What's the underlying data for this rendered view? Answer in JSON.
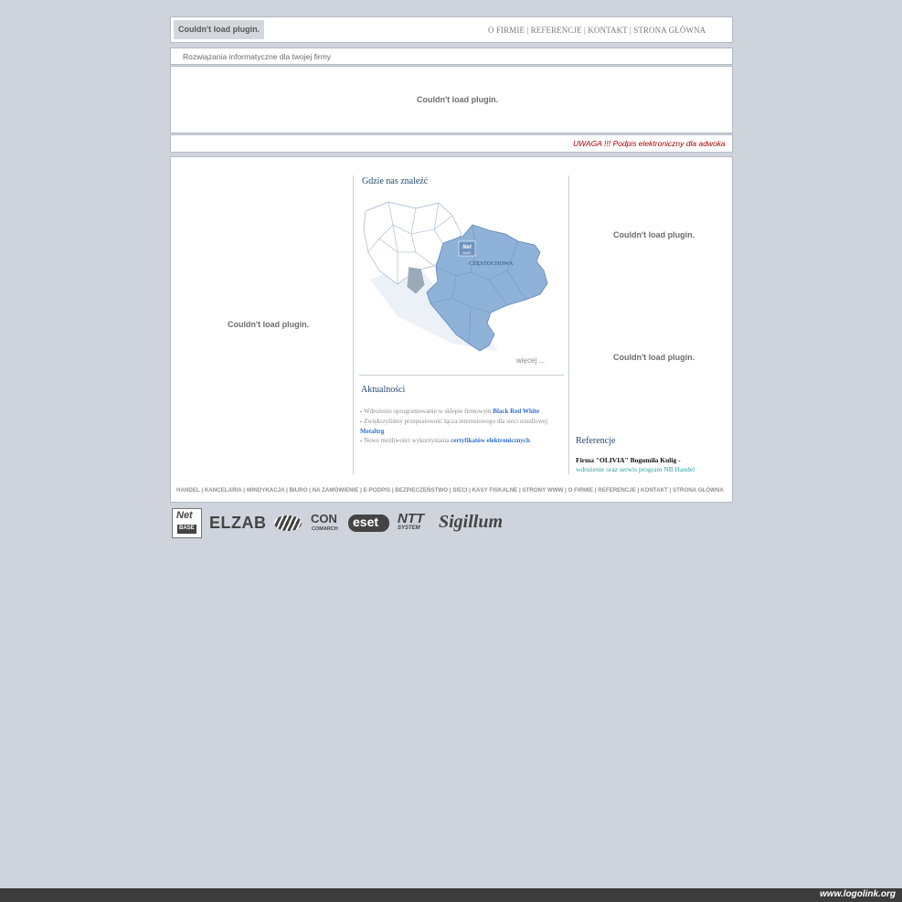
{
  "header": {
    "plugin_text": "Couldn't load plugin.",
    "nav": [
      "O FIRMIE",
      "REFERENCJE",
      "KONTAKT",
      "STRONA GŁÓWNA"
    ]
  },
  "tagline": "Rozwiązania informatyczne dla twojej firmy",
  "banner": {
    "plugin_text": "Couldn't load plugin."
  },
  "ticker": {
    "text": "UWAGA !!! Podpis elektroniczny dla adwokatów"
  },
  "left_column": {
    "plugin_text": "Couldn't load plugin."
  },
  "center_column": {
    "find_us_title": "Gdzie nas znaleźć",
    "map": {
      "city_label": "CZĘSTOCHOWA",
      "pin_logo_top": "Net",
      "pin_logo_bottom": "BASE"
    },
    "more_link": "więcej ...",
    "news_title": "Aktualności",
    "news": [
      {
        "dash": "-",
        "text": "Wdrożenie oprogramowanie w sklepie firmowym ",
        "link": "Black Red White"
      },
      {
        "dash": "-",
        "text": "Zwiększyliśmy przepustowość łącza internetowego dla sieci osiedlowej ",
        "link": "Metaltrg"
      },
      {
        "dash": "-",
        "text": "Nowe możliwości wykorzystania ",
        "link": "certyfikatów elektronicznych"
      }
    ]
  },
  "right_column": {
    "plugin_text_1": "Couldn't load plugin.",
    "plugin_text_2": "Couldn't load plugin.",
    "references_title": "Referencje",
    "reference_name": "Firma \"OLIVIA\" Bogumiła Kulig -",
    "reference_desc": "wdrożenie oraz serwis program NB Handel"
  },
  "footer_nav": [
    "HANDEL",
    "KANCELARIA",
    "WINDYKACJA",
    "BIURO",
    "NA ZAMÓWIENIE",
    "E-PODPIS",
    "BEZPIECZEŃSTWO",
    "SIECI",
    "KASY FISKALNE",
    "STRONY WWW",
    "O FIRMIE",
    "REFERENCJE",
    "KONTAKT",
    "STRONA GŁÓWNA"
  ],
  "partner_logos": {
    "netbase_top": "Net",
    "netbase_bottom": "BASE",
    "elzab": "ELZAB",
    "comarch_top": "CON",
    "comarch_bottom": "COMARCH",
    "eset": "eset",
    "ntt_top": "NTT",
    "ntt_bottom": "SYSTEM",
    "sigillum": "Sigillum"
  },
  "watermark": "www.logolink.org",
  "colors": {
    "background": "#cfd4dc",
    "map_fill": "#8fb2d9",
    "ticker": "#a50000",
    "heading": "#23496e",
    "link": "#2f6fd0"
  }
}
